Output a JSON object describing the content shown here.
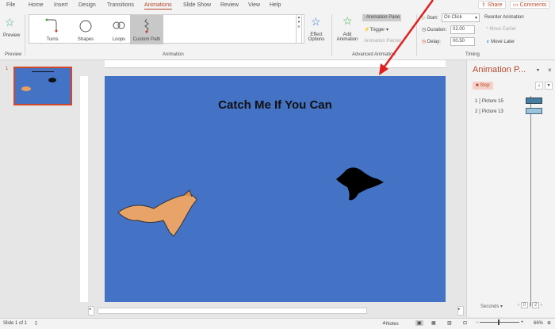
{
  "tabs": [
    "File",
    "Home",
    "Insert",
    "Design",
    "Transitions",
    "Animations",
    "Slide Show",
    "Review",
    "View",
    "Help"
  ],
  "active_tab": "Animations",
  "share": "Share",
  "comments": "Comments",
  "preview": {
    "label": "Preview",
    "group": "Preview"
  },
  "gallery": {
    "items": [
      "Turns",
      "Shapes",
      "Loops",
      "Custom Path"
    ],
    "selected": "Custom Path",
    "group": "Animation"
  },
  "effect_options": "Effect Options",
  "advanced": {
    "add_animation": "Add Animation",
    "animation_pane": "Animation Pane",
    "trigger": "Trigger",
    "painter": "Animation Painter",
    "group": "Advanced Animation"
  },
  "timing": {
    "start_label": "Start:",
    "start_value": "On Click",
    "duration_label": "Duration:",
    "duration_value": "02.00",
    "delay_label": "Delay:",
    "delay_value": "00.50",
    "reorder": "Reorder Animation",
    "move_earlier": "Move Earlier",
    "move_later": "Move Later",
    "group": "Timing"
  },
  "slide_number": "1",
  "slide": {
    "title": "Catch Me If You Can",
    "bg": "#4472c4"
  },
  "pane": {
    "title": "Animation P...",
    "stop": "Stop",
    "items": [
      {
        "n": "1",
        "name": "Picture 15"
      },
      {
        "n": "2",
        "name": "Picture 13"
      }
    ],
    "seconds": "Seconds",
    "scale": [
      "0",
      "2"
    ]
  },
  "status": {
    "slide": "Slide 1 of 1",
    "notes": "Notes",
    "zoom": "66%"
  },
  "colors": {
    "accent": "#b7472a",
    "arrow": "#e02020"
  }
}
